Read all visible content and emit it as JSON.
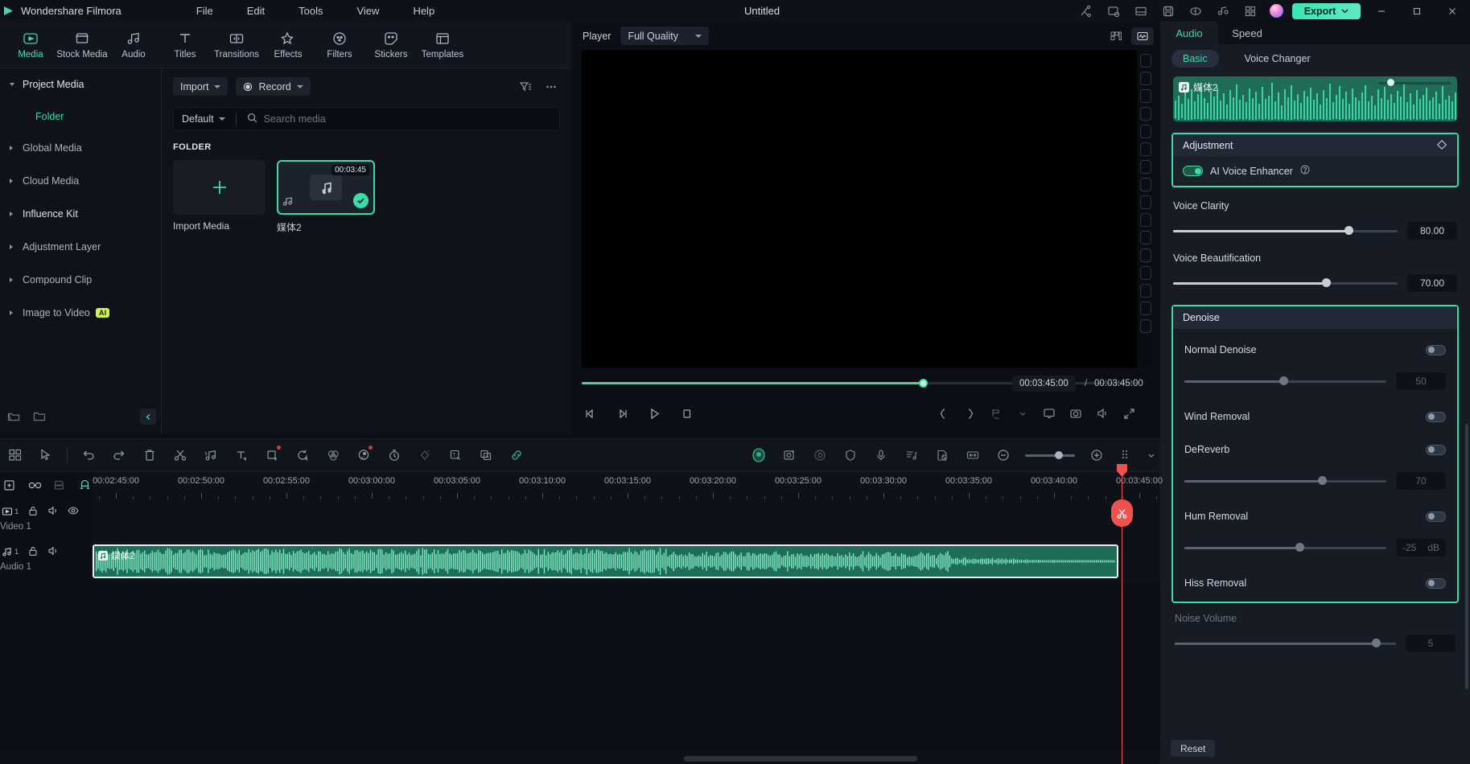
{
  "titlebar": {
    "brand": "Wondershare Filmora",
    "menus": [
      "File",
      "Edit",
      "Tools",
      "View",
      "Help"
    ],
    "project_title": "Untitled",
    "export_label": "Export",
    "icons": [
      "share-icon",
      "project-settings-icon",
      "layout-icon",
      "save-icon",
      "render-preview-icon",
      "audio-detach-icon",
      "grid-apps-icon"
    ],
    "window_controls": [
      "minimize",
      "maximize",
      "close"
    ]
  },
  "toptabs": [
    {
      "label": "Media",
      "icon": "media-icon",
      "active": true
    },
    {
      "label": "Stock Media",
      "icon": "stock-media-icon",
      "active": false
    },
    {
      "label": "Audio",
      "icon": "audio-icon",
      "active": false
    },
    {
      "label": "Titles",
      "icon": "titles-icon",
      "active": false
    },
    {
      "label": "Transitions",
      "icon": "transitions-icon",
      "active": false
    },
    {
      "label": "Effects",
      "icon": "effects-icon",
      "active": false
    },
    {
      "label": "Filters",
      "icon": "filters-icon",
      "active": false
    },
    {
      "label": "Stickers",
      "icon": "stickers-icon",
      "active": false
    },
    {
      "label": "Templates",
      "icon": "templates-icon",
      "active": false
    }
  ],
  "sidebar": {
    "items": [
      {
        "label": "Project Media",
        "expanded": true
      },
      {
        "label": "Global Media",
        "expanded": false
      },
      {
        "label": "Cloud Media",
        "expanded": false
      },
      {
        "label": "Influence Kit",
        "expanded": false
      },
      {
        "label": "Adjustment Layer",
        "expanded": false
      },
      {
        "label": "Compound Clip",
        "expanded": false
      },
      {
        "label": "Image to Video",
        "expanded": false,
        "badge": "AI"
      }
    ],
    "sub_item": "Folder"
  },
  "media_panel": {
    "import_label": "Import",
    "record_label": "Record",
    "sort_label": "Default",
    "search_placeholder": "Search media",
    "search_value": "",
    "folder_header": "FOLDER",
    "import_card_label": "Import Media",
    "items": [
      {
        "name": "媒体2",
        "duration": "00:03:45",
        "selected": true,
        "type": "audio"
      }
    ]
  },
  "player": {
    "label": "Player",
    "quality": "Full Quality",
    "current_time": "00:03:45:00",
    "separator": "/",
    "total_time": "00:03:45:00",
    "progress_percent": 61.5,
    "controls": [
      "prev-frame-icon",
      "next-frame-icon",
      "play-icon",
      "stop-icon"
    ],
    "right_controls": [
      "mark-in-icon",
      "mark-out-icon",
      "export-frame-icon",
      "chevron-down-icon",
      "pop-out-icon",
      "snapshot-icon",
      "volume-icon",
      "fullscreen-icon"
    ],
    "top_right_icons": [
      "grid-view-icon",
      "waveform-view-icon"
    ]
  },
  "right_panel": {
    "tabs": [
      {
        "label": "Audio",
        "active": true
      },
      {
        "label": "Speed",
        "active": false
      }
    ],
    "subtabs": [
      {
        "label": "Basic",
        "active": true
      },
      {
        "label": "Voice Changer",
        "active": false
      }
    ],
    "clip_name": "媒体2",
    "adjustment": {
      "title": "Adjustment",
      "keyframe_icon": "diamond-keyframe-icon",
      "ai_voice_enhancer": {
        "label": "AI Voice Enhancer",
        "enabled": true,
        "help_icon": "help-circle-icon"
      }
    },
    "sliders": [
      {
        "label": "Voice Clarity",
        "value": "80.00",
        "percent": 78,
        "enabled": true
      },
      {
        "label": "Voice Beautification",
        "value": "70.00",
        "percent": 68,
        "enabled": true
      }
    ],
    "denoise": {
      "title": "Denoise",
      "rows": [
        {
          "label": "Normal Denoise",
          "enabled": false,
          "has_slider": true,
          "value": "50",
          "percent": 49,
          "unit": ""
        },
        {
          "label": "Wind Removal",
          "enabled": false,
          "has_slider": false
        },
        {
          "label": "DeReverb",
          "enabled": false,
          "has_slider": true,
          "value": "70",
          "percent": 68,
          "unit": ""
        },
        {
          "label": "Hum Removal",
          "enabled": false,
          "has_slider": true,
          "value": "-25",
          "percent": 57,
          "unit": "dB"
        },
        {
          "label": "Hiss Removal",
          "enabled": false,
          "has_slider": false
        }
      ]
    },
    "noise_volume": {
      "label": "Noise Volume",
      "value": "5",
      "percent": 92
    },
    "reset_label": "Reset"
  },
  "timeline": {
    "toolbar_left_icons": [
      "layout-grid-icon",
      "select-tool-icon"
    ],
    "toolbar_icons": [
      "undo-icon",
      "redo-icon",
      "delete-icon",
      "split-icon",
      "audio-detect-icon",
      "text-icon",
      "crop-icon",
      "rotate-icon",
      "color-match-icon",
      "ai-audio-icon",
      "speed-icon",
      "keyframe-icon",
      "motion-track-icon",
      "auto-caption-icon",
      "link-icon"
    ],
    "center_icons": [
      "ai-mask-icon",
      "ai-portrait-icon",
      "ai-copilot-icon",
      "shield-icon",
      "mic-icon",
      "audio-mixer-icon",
      "silence-detect-icon",
      "fit-icon"
    ],
    "zoom_out_icon": "zoom-out-icon",
    "zoom_in_icon": "zoom-in-icon",
    "zoom_percent": 60,
    "track_action_icons": [
      "add-track-icon",
      "link-track-icon",
      "markers-icon",
      "magnet-icon"
    ],
    "ruler_labels": [
      "00:02:45:00",
      "00:02:50:00",
      "00:02:55:00",
      "00:03:00:00",
      "00:03:05:00",
      "00:03:10:00",
      "00:03:15:00",
      "00:03:20:00",
      "00:03:25:00",
      "00:03:30:00",
      "00:03:35:00",
      "00:03:40:00",
      "00:03:45:00"
    ],
    "playhead_time": "00:03:45:00",
    "tracks": [
      {
        "name": "Video 1",
        "number": "1",
        "type": "video",
        "icons": [
          "video-track-icon",
          "lock-icon",
          "mute-icon",
          "eye-icon"
        ],
        "clips": []
      },
      {
        "name": "Audio 1",
        "number": "1",
        "type": "audio",
        "icons": [
          "audio-track-icon",
          "lock-icon",
          "mute-icon"
        ],
        "clips": [
          {
            "label": "媒体2",
            "selected": true
          }
        ]
      }
    ]
  }
}
